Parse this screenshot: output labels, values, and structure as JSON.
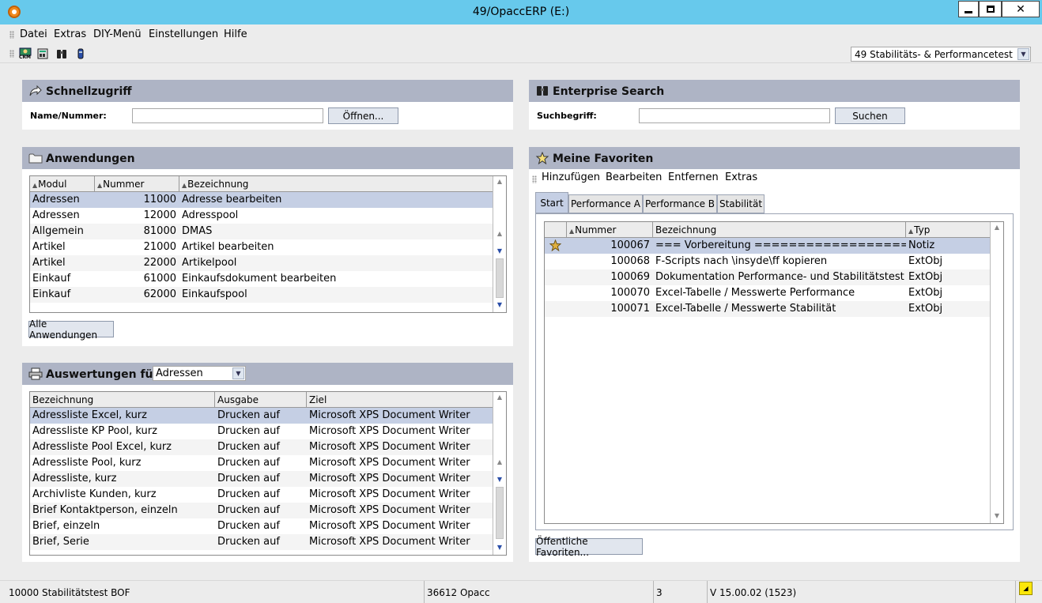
{
  "window": {
    "title": "49/OpaccERP (E:)"
  },
  "menu": [
    "Datei",
    "Extras",
    "DIY-Menü",
    "Einstellungen",
    "Hilfe"
  ],
  "toolbar": {
    "icons": [
      "crm-icon",
      "accounting-icon",
      "binoculars-icon",
      "flashlight-icon"
    ],
    "crm_label": "CRM",
    "mandant": "49 Stabilitäts- & Performancetest"
  },
  "schnellzugriff": {
    "title": "Schnellzugriff",
    "label": "Name/Nummer:",
    "value": "",
    "button": "Öffnen..."
  },
  "anwendungen": {
    "title": "Anwendungen",
    "columns": [
      "Modul",
      "Nummer",
      "Bezeichnung"
    ],
    "rows": [
      [
        "Adressen",
        "11000",
        "Adresse bearbeiten"
      ],
      [
        "Adressen",
        "12000",
        "Adresspool"
      ],
      [
        "Allgemein",
        "81000",
        "DMAS"
      ],
      [
        "Artikel",
        "21000",
        "Artikel bearbeiten"
      ],
      [
        "Artikel",
        "22000",
        "Artikelpool"
      ],
      [
        "Einkauf",
        "61000",
        "Einkaufsdokument bearbeiten"
      ],
      [
        "Einkauf",
        "62000",
        "Einkaufspool"
      ]
    ],
    "button": "Alle Anwendungen"
  },
  "auswertungen": {
    "title": "Auswertungen für",
    "filter": "Adressen",
    "columns": [
      "Bezeichnung",
      "Ausgabe",
      "Ziel"
    ],
    "rows": [
      [
        "Adressliste Excel, kurz",
        "Drucken auf",
        "Microsoft XPS Document Writer"
      ],
      [
        "Adressliste KP Pool, kurz",
        "Drucken auf",
        "Microsoft XPS Document Writer"
      ],
      [
        "Adressliste Pool Excel, kurz",
        "Drucken auf",
        "Microsoft XPS Document Writer"
      ],
      [
        "Adressliste Pool, kurz",
        "Drucken auf",
        "Microsoft XPS Document Writer"
      ],
      [
        "Adressliste, kurz",
        "Drucken auf",
        "Microsoft XPS Document Writer"
      ],
      [
        "Archivliste Kunden, kurz",
        "Drucken auf",
        "Microsoft XPS Document Writer"
      ],
      [
        "Brief Kontaktperson, einzeln",
        "Drucken auf",
        "Microsoft XPS Document Writer"
      ],
      [
        "Brief, einzeln",
        "Drucken auf",
        "Microsoft XPS Document Writer"
      ],
      [
        "Brief, Serie",
        "Drucken auf",
        "Microsoft XPS Document Writer"
      ]
    ]
  },
  "enterprise_search": {
    "title": "Enterprise Search",
    "label": "Suchbegriff:",
    "value": "",
    "button": "Suchen"
  },
  "favoriten": {
    "title": "Meine Favoriten",
    "menu": [
      "Hinzufügen",
      "Bearbeiten",
      "Entfernen",
      "Extras"
    ],
    "tabs": [
      "Start",
      "Performance A",
      "Performance B",
      "Stabilität"
    ],
    "columns": [
      "Nummer",
      "Bezeichnung",
      "Typ"
    ],
    "rows": [
      [
        "100067",
        "=== Vorbereitung =======================",
        "Notiz"
      ],
      [
        "100068",
        "F-Scripts nach \\insyde\\ff kopieren",
        "ExtObj"
      ],
      [
        "100069",
        "Dokumentation Performance- und Stabilitätstest",
        "ExtObj"
      ],
      [
        "100070",
        "Excel-Tabelle / Messwerte Performance",
        "ExtObj"
      ],
      [
        "100071",
        "Excel-Tabelle / Messwerte Stabilität",
        "ExtObj"
      ]
    ],
    "button": "Öffentliche Favoriten..."
  },
  "statusbar": [
    "10000 Stabilitätstest BOF",
    "36612 Opacc",
    "3",
    "V 15.00.02 (1523)"
  ],
  "colors": {
    "titlebar": "#67c9ec",
    "panel_header": "#aeb4c5",
    "selection": "#c5cfe4",
    "button": "#e1e6ee"
  }
}
